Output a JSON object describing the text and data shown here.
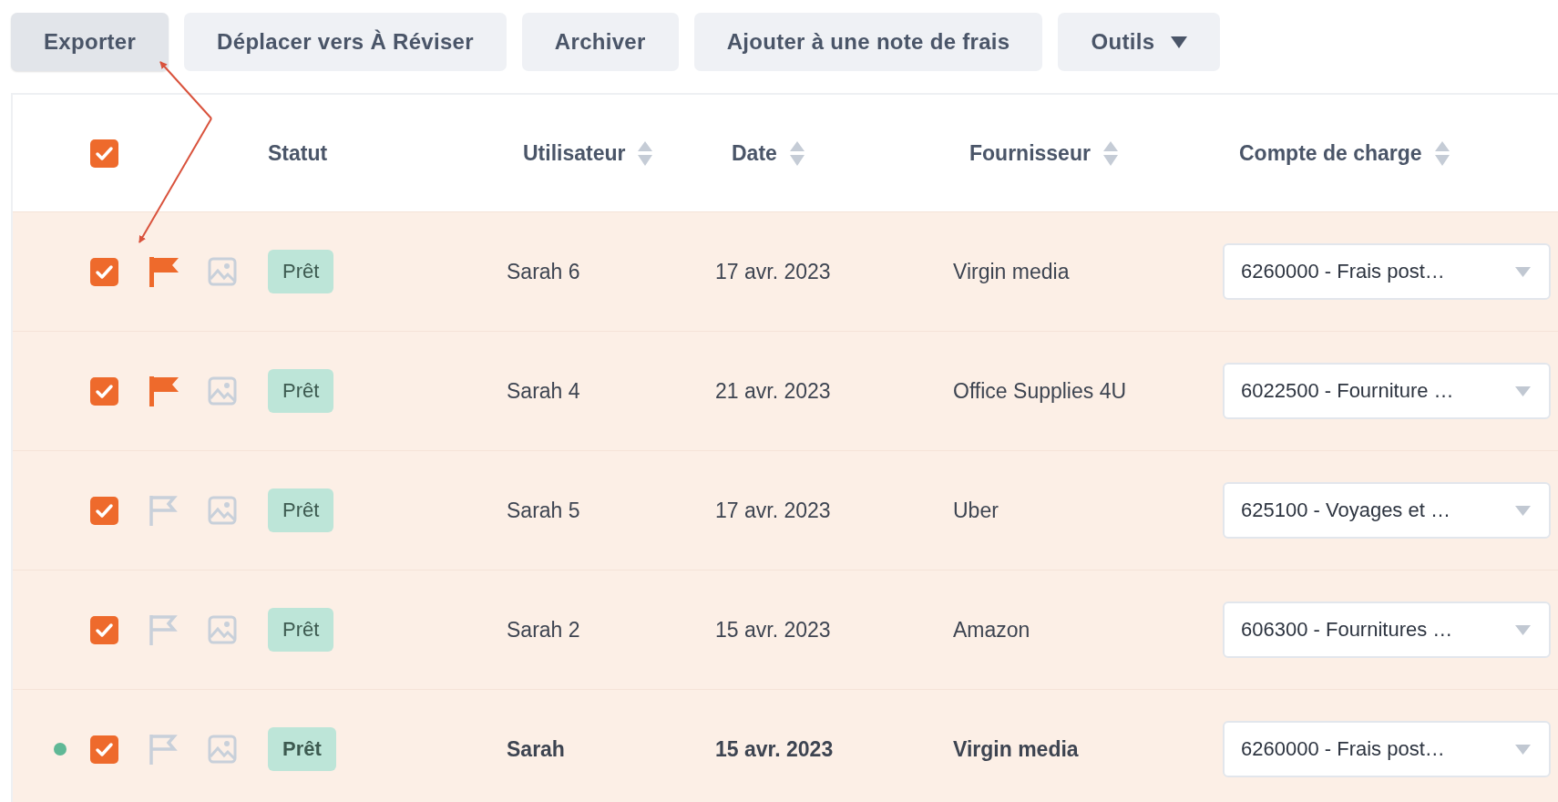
{
  "toolbar": {
    "buttons": [
      {
        "label": "Exporter",
        "kind": "button",
        "active": true
      },
      {
        "label": "Déplacer vers À Réviser",
        "kind": "button",
        "active": false
      },
      {
        "label": "Archiver",
        "kind": "button",
        "active": false
      },
      {
        "label": "Ajouter à une note de frais",
        "kind": "button",
        "active": false
      },
      {
        "label": "Outils",
        "kind": "dropdown",
        "active": false
      }
    ]
  },
  "table": {
    "select_all_checked": true,
    "columns": [
      {
        "label": "Statut",
        "sortable": false
      },
      {
        "label": "Utilisateur",
        "sortable": true
      },
      {
        "label": "Date",
        "sortable": true
      },
      {
        "label": "Fournisseur",
        "sortable": true
      },
      {
        "label": "Compte de charge",
        "sortable": true
      }
    ],
    "rows": [
      {
        "unread": false,
        "checked": true,
        "flagged": true,
        "status": "Prêt",
        "user": "Sarah 6",
        "date": "17 avr. 2023",
        "supplier": "Virgin media",
        "account": "6260000 - Frais post…"
      },
      {
        "unread": false,
        "checked": true,
        "flagged": true,
        "status": "Prêt",
        "user": "Sarah 4",
        "date": "21 avr. 2023",
        "supplier": "Office Supplies 4U",
        "account": "6022500 - Fourniture …"
      },
      {
        "unread": false,
        "checked": true,
        "flagged": false,
        "status": "Prêt",
        "user": "Sarah 5",
        "date": "17 avr. 2023",
        "supplier": "Uber",
        "account": "625100 - Voyages et …"
      },
      {
        "unread": false,
        "checked": true,
        "flagged": false,
        "status": "Prêt",
        "user": "Sarah 2",
        "date": "15 avr. 2023",
        "supplier": "Amazon",
        "account": "606300 - Fournitures …"
      },
      {
        "unread": true,
        "checked": true,
        "flagged": false,
        "status": "Prêt",
        "user": "Sarah",
        "date": "15 avr. 2023",
        "supplier": "Virgin media",
        "account": "6260000 - Frais post…"
      }
    ]
  }
}
